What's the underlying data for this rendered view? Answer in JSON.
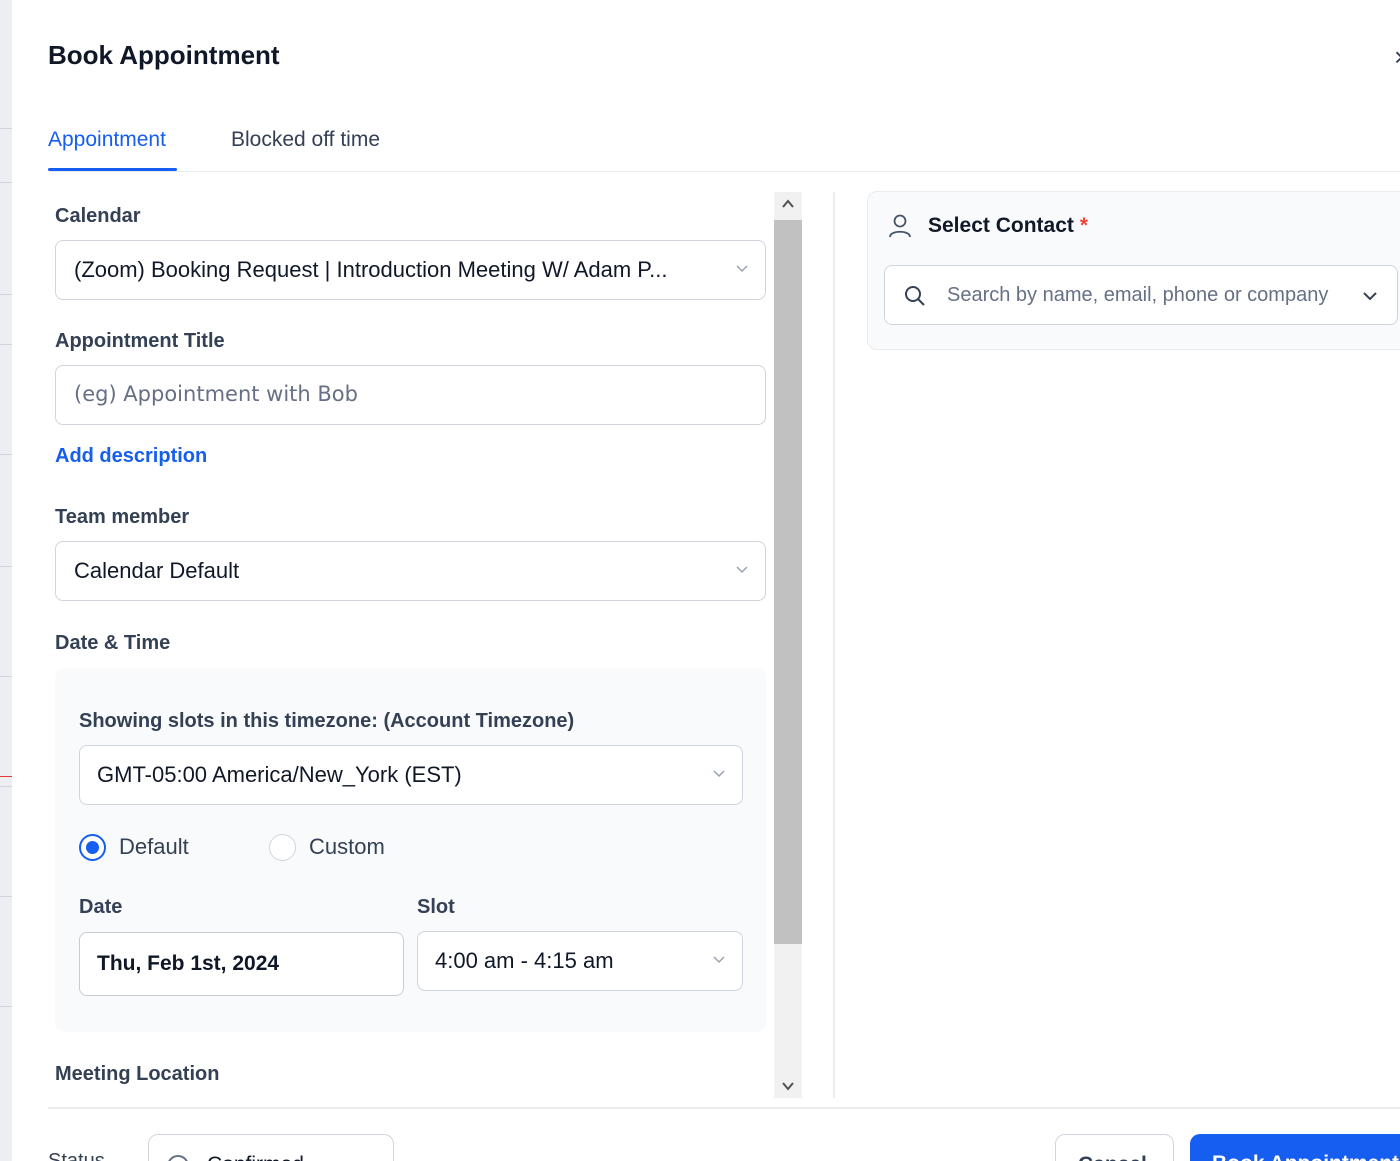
{
  "modal": {
    "title": "Book Appointment",
    "close_icon": "×"
  },
  "tabs": [
    {
      "label": "Appointment",
      "active": true
    },
    {
      "label": "Blocked off time",
      "active": false
    }
  ],
  "form": {
    "calendar": {
      "label": "Calendar",
      "value": "(Zoom) Booking Request | Introduction Meeting W/ Adam P..."
    },
    "appointment_title": {
      "label": "Appointment Title",
      "placeholder": "(eg) Appointment with Bob"
    },
    "add_description": "Add description",
    "team_member": {
      "label": "Team member",
      "value": "Calendar Default"
    },
    "date_time": {
      "label": "Date & Time",
      "timezone_label": "Showing slots in this timezone: (Account Timezone)",
      "timezone_value": "GMT-05:00 America/New_York (EST)",
      "radio_default": "Default",
      "radio_custom": "Custom",
      "selected_mode": "Default",
      "date_label": "Date",
      "date_value": "Thu, Feb 1st, 2024",
      "slot_label": "Slot",
      "slot_value": "4:00 am - 4:15 am"
    },
    "meeting_location_label": "Meeting Location"
  },
  "contact": {
    "title": "Select Contact",
    "required_mark": "*",
    "search_placeholder": "Search by name, email, phone or company"
  },
  "footer": {
    "status_label": "Status",
    "status_value": "Confirmed",
    "cancel_label": "Cancel",
    "book_label": "Book Appointment"
  },
  "colors": {
    "accent": "#155eef",
    "border": "#d0d5dd",
    "panel_bg": "#f9fafb",
    "required": "#f04438"
  },
  "icons": {
    "close": "close-icon",
    "chevron": "chevron-down-icon",
    "user": "user-icon",
    "search": "search-icon"
  }
}
